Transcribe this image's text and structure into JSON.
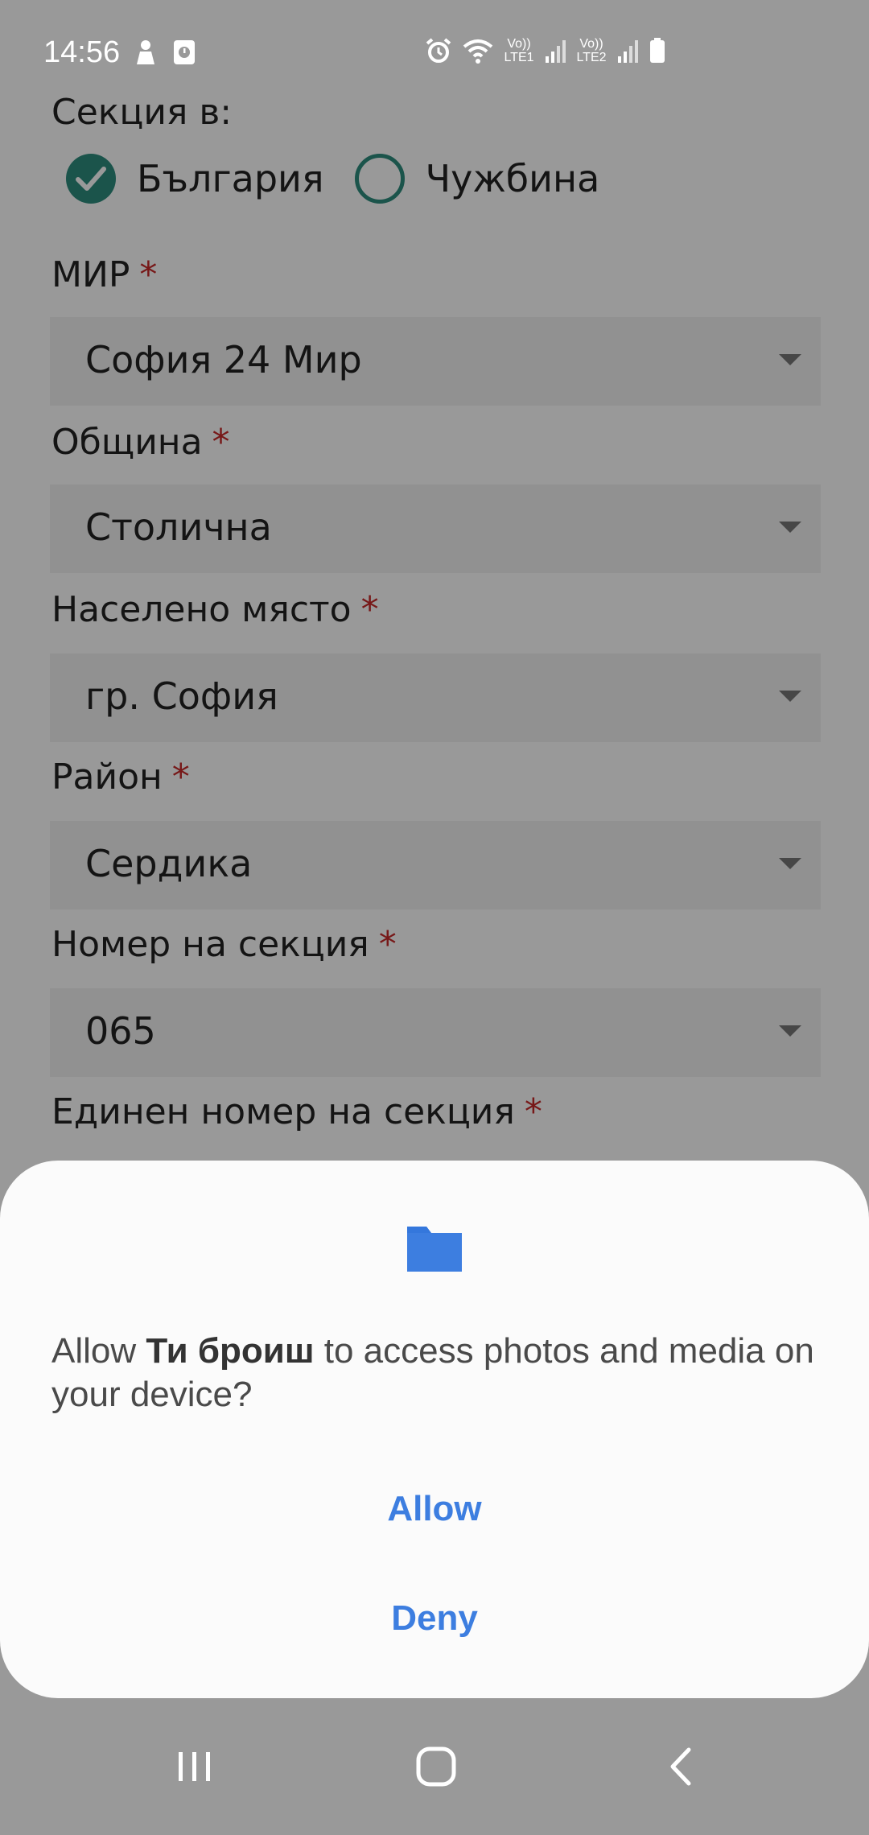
{
  "status_bar": {
    "time": "14:56",
    "sim1_label": "Vo)) LTE1",
    "sim2_label": "Vo)) LTE2",
    "icons": [
      "person-icon",
      "screenshot-icon",
      "alarm-icon",
      "wifi-icon",
      "signal-icon",
      "battery-icon"
    ]
  },
  "form": {
    "section_label": "Секция в:",
    "radio_options": [
      {
        "label": "България",
        "checked": true
      },
      {
        "label": "Чужбина",
        "checked": false
      }
    ],
    "required_mark": "*",
    "fields": [
      {
        "label": "МИР",
        "value": "София 24 Мир"
      },
      {
        "label": "Община",
        "value": "Столична"
      },
      {
        "label": "Населено място",
        "value": "гр. София"
      },
      {
        "label": "Район",
        "value": "Сердика"
      },
      {
        "label": "Номер на секция",
        "value": "065"
      },
      {
        "label": "Единен номер на секция",
        "value": ""
      }
    ]
  },
  "dialog": {
    "icon": "folder-icon",
    "message_prefix": "Allow ",
    "app_name": "Ти броиш",
    "message_suffix": " to access photos and media on your device?",
    "allow_label": "Allow",
    "deny_label": "Deny"
  },
  "colors": {
    "accent_teal": "#2e8c7e",
    "required_red": "#c62828",
    "dialog_button_blue": "#3d7ee0"
  },
  "navigation": {
    "buttons": [
      "recents-icon",
      "home-icon",
      "back-icon"
    ]
  }
}
